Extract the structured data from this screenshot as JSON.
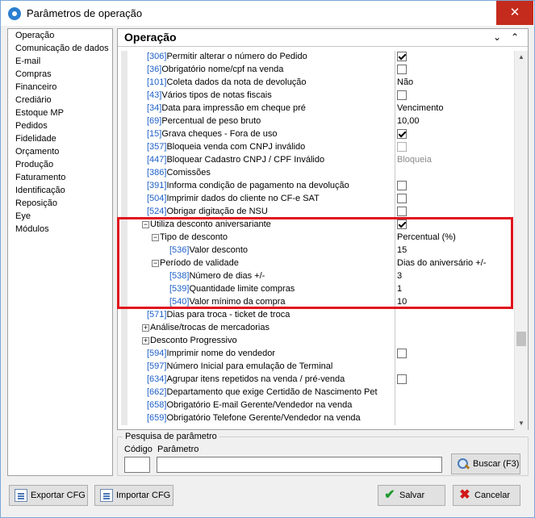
{
  "window": {
    "title": "Parâmetros de operação",
    "close_glyph": "✕"
  },
  "sidebar": {
    "items": [
      "Operação",
      "Comunicação de dados",
      "E-mail",
      "Compras",
      "Financeiro",
      "Crediário",
      "Estoque MP",
      "Pedidos",
      "Fidelidade",
      "Orçamento",
      "Produção",
      "Faturamento",
      "Identificação",
      "Reposição",
      "Eye",
      "Módulos"
    ]
  },
  "section": {
    "title": "Operação",
    "collapse_glyph": "⌄",
    "expand_glyph": "⌃"
  },
  "rows": [
    {
      "code": "[306]",
      "label": "Permitir alterar o número do Pedido",
      "type": "check",
      "checked": true
    },
    {
      "code": "[36]",
      "label": "Obrigatório nome/cpf na venda",
      "type": "check",
      "checked": false
    },
    {
      "code": "[101]",
      "label": "Coleta dados da nota de devolução",
      "type": "text",
      "value": "Não"
    },
    {
      "code": "[43]",
      "label": "Vários tipos de notas fiscais",
      "type": "check",
      "checked": false
    },
    {
      "code": "[34]",
      "label": "Data para impressão em cheque pré",
      "type": "text",
      "value": "Vencimento"
    },
    {
      "code": "[69]",
      "label": "Percentual de peso bruto",
      "type": "text",
      "value": "10,00"
    },
    {
      "code": "[15]",
      "label": "Grava cheques - Fora de uso",
      "type": "check",
      "checked": true
    },
    {
      "code": "[357]",
      "label": "Bloqueia venda com CNPJ inválido",
      "type": "check",
      "checked": false,
      "disabled": true
    },
    {
      "code": "[447]",
      "label": "Bloquear Cadastro CNPJ / CPF Inválido",
      "type": "text",
      "value": "Bloqueia",
      "disabled": true
    },
    {
      "code": "[386]",
      "label": "Comissões",
      "type": "none"
    },
    {
      "code": "[391]",
      "label": "Informa condição de pagamento na devolução",
      "type": "check",
      "checked": false
    },
    {
      "code": "[504]",
      "label": "Imprimir dados do cliente no CF-e SAT",
      "type": "check",
      "checked": false
    },
    {
      "code": "[524]",
      "label": "Obrigar digitação de NSU",
      "type": "check",
      "checked": false
    },
    {
      "code": "",
      "label": "Utiliza desconto aniversariante",
      "type": "check",
      "checked": true,
      "group": "−"
    },
    {
      "code": "",
      "label": "Tipo de desconto",
      "type": "text",
      "value": "Percentual (%)",
      "group": "−"
    },
    {
      "code": "[536]",
      "label": "Valor desconto",
      "type": "text",
      "value": "15"
    },
    {
      "code": "",
      "label": "Período de validade",
      "type": "text",
      "value": "Dias do aniversário +/-",
      "group": "−"
    },
    {
      "code": "[538]",
      "label": "Número de dias +/-",
      "type": "text",
      "value": "3"
    },
    {
      "code": "[539]",
      "label": "Quantidade limite compras",
      "type": "text",
      "value": "1"
    },
    {
      "code": "[540]",
      "label": "Valor mínimo da compra",
      "type": "text",
      "value": "10"
    },
    {
      "code": "[571]",
      "label": "Dias para troca - ticket de troca",
      "type": "none"
    },
    {
      "code": "",
      "label": "Análise/trocas de mercadorias",
      "type": "none",
      "group": "+"
    },
    {
      "code": "",
      "label": "Desconto Progressivo",
      "type": "none",
      "group": "+"
    },
    {
      "code": "[594]",
      "label": "Imprimir nome do vendedor",
      "type": "check",
      "checked": false
    },
    {
      "code": "[597]",
      "label": "Número Inicial para emulação de Terminal",
      "type": "none"
    },
    {
      "code": "[634]",
      "label": "Agrupar itens repetidos na venda / pré-venda",
      "type": "check",
      "checked": false
    },
    {
      "code": "[662]",
      "label": "Departamento que exige Certidão de Nascimento Pet",
      "type": "none"
    },
    {
      "code": "[658]",
      "label": "Obrigatório E-mail Gerente/Vendedor na venda",
      "type": "none"
    },
    {
      "code": "[659]",
      "label": "Obrigatório Telefone Gerente/Vendedor na venda",
      "type": "none"
    }
  ],
  "search": {
    "legend": "Pesquisa de parâmetro",
    "code_label": "Código",
    "param_label": "Parâmetro",
    "button": "Buscar (F3)"
  },
  "buttons": {
    "export": "Exportar CFG",
    "import": "Importar CFG",
    "save": "Salvar",
    "cancel": "Cancelar"
  }
}
